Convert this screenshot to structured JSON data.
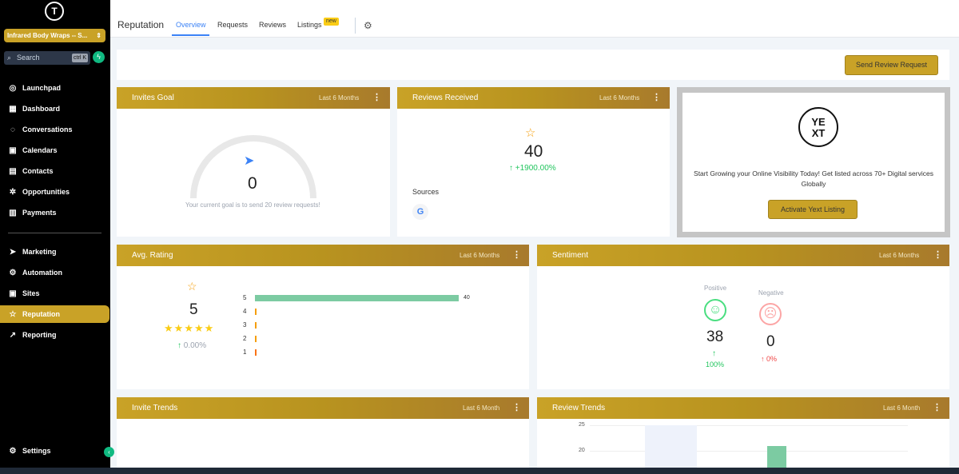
{
  "sidebar": {
    "logo_text": "T",
    "account_name": "Infrared Body Wraps -- S...",
    "search_placeholder": "Search",
    "search_shortcut": "ctrl K",
    "items": [
      {
        "label": "Launchpad",
        "icon": "rocket-icon",
        "glyph": "◎"
      },
      {
        "label": "Dashboard",
        "icon": "dashboard-icon",
        "glyph": "▦"
      },
      {
        "label": "Conversations",
        "icon": "chat-icon",
        "glyph": "◌"
      },
      {
        "label": "Calendars",
        "icon": "calendar-icon",
        "glyph": "▣"
      },
      {
        "label": "Contacts",
        "icon": "contacts-icon",
        "glyph": "▤"
      },
      {
        "label": "Opportunities",
        "icon": "opportunities-icon",
        "glyph": "✲"
      },
      {
        "label": "Payments",
        "icon": "payments-icon",
        "glyph": "▥"
      },
      {
        "label": "Marketing",
        "icon": "send-icon",
        "glyph": "➤"
      },
      {
        "label": "Automation",
        "icon": "automation-icon",
        "glyph": "⚙"
      },
      {
        "label": "Sites",
        "icon": "sites-icon",
        "glyph": "▣"
      },
      {
        "label": "Reputation",
        "icon": "star-icon",
        "glyph": "☆"
      },
      {
        "label": "Reporting",
        "icon": "trend-icon",
        "glyph": "↗"
      }
    ],
    "settings_label": "Settings"
  },
  "topbar": {
    "title": "Reputation",
    "tabs": [
      "Overview",
      "Requests",
      "Reviews",
      "Listings"
    ],
    "new_badge": "new",
    "header_icons": [
      {
        "name": "help-icon",
        "glyph": "?",
        "color": "#111111"
      },
      {
        "name": "phone-icon",
        "glyph": "✆",
        "color": "#22c55e"
      },
      {
        "name": "megaphone-icon",
        "glyph": "◀",
        "color": "#16a34a"
      },
      {
        "name": "bell-icon",
        "glyph": "♪",
        "color": "#f97316"
      },
      {
        "name": "question-icon",
        "glyph": "?",
        "color": "#3b82f6"
      }
    ]
  },
  "actions": {
    "send_review_request": "Send Review Request",
    "activate_yext": "Activate Yext Listing"
  },
  "invites_goal": {
    "title": "Invites Goal",
    "period": "Last 6 Months",
    "value": "0",
    "caption": "Your current goal is to send 20 review requests!"
  },
  "reviews_received": {
    "title": "Reviews Received",
    "period": "Last 6 Months",
    "value": "40",
    "change": "+1900.00%",
    "sources_label": "Sources"
  },
  "yext": {
    "logo_top": "YE",
    "logo_bottom": "XT",
    "text": "Start Growing your Online Visibility Today! Get listed across 70+ Digital services Globally"
  },
  "avg_rating": {
    "title": "Avg. Rating",
    "period": "Last 6 Months",
    "value": "5",
    "change": "0.00%",
    "stars": 5,
    "distribution": [
      {
        "label": "5",
        "count": 40,
        "count_label": "40",
        "color": "#7ccba2"
      },
      {
        "label": "4",
        "count": 0,
        "color": "#f59e0b"
      },
      {
        "label": "3",
        "count": 0,
        "color": "#f59e0b"
      },
      {
        "label": "2",
        "count": 0,
        "color": "#f59e0b"
      },
      {
        "label": "1",
        "count": 0,
        "color": "#f97316"
      }
    ]
  },
  "sentiment": {
    "title": "Sentiment",
    "period": "Last 6 Months",
    "positive_label": "Positive",
    "positive_value": "38",
    "positive_change": "100%",
    "negative_label": "Negative",
    "negative_value": "0",
    "negative_change": "0%"
  },
  "invite_trends": {
    "title": "Invite Trends",
    "period": "Last 6 Month"
  },
  "review_trends": {
    "title": "Review Trends",
    "period": "Last 6 Month",
    "y_ticks": [
      "25",
      "20"
    ]
  },
  "colors": {
    "brand_gold": "#c9a227",
    "positive_green": "#22c55e",
    "negative_red": "#ef4444",
    "tab_active": "#3b82f6"
  }
}
